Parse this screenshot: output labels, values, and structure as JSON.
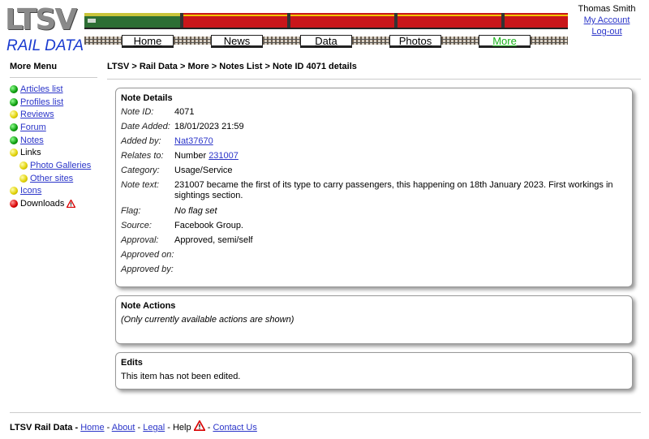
{
  "header": {
    "logo_text": "LTSV",
    "logo_subtext": "RAIL DATA",
    "nav": [
      {
        "label": "Home"
      },
      {
        "label": "News"
      },
      {
        "label": "Data"
      },
      {
        "label": "Photos"
      },
      {
        "label": "More"
      }
    ],
    "user": {
      "name": "Thomas Smith",
      "account": "My Account",
      "logout": "Log-out"
    }
  },
  "sidebar": {
    "title": "More Menu",
    "items": [
      {
        "label": "Articles list",
        "color": "#0a9a0a",
        "icon": "green-dot-icon",
        "link": true
      },
      {
        "label": "Profiles list",
        "color": "#0a9a0a",
        "icon": "green-dot-icon",
        "link": true
      },
      {
        "label": "Reviews",
        "color": "#e0d000",
        "icon": "yellow-dot-icon",
        "link": true
      },
      {
        "label": "Forum",
        "color": "#0a9a0a",
        "icon": "green-dot-icon",
        "link": true
      },
      {
        "label": "Notes",
        "color": "#0a9a0a",
        "icon": "green-dot-icon",
        "link": true
      },
      {
        "label": "Links",
        "color": "#e0d000",
        "icon": "yellow-dot-icon",
        "link": false
      },
      {
        "label": "Photo Galleries",
        "color": "#e0d000",
        "icon": "yellow-dot-icon",
        "link": true
      },
      {
        "label": "Other sites",
        "color": "#e0d000",
        "icon": "yellow-dot-icon",
        "link": true
      },
      {
        "label": "Icons",
        "color": "#e0d000",
        "icon": "yellow-dot-icon",
        "link": true
      },
      {
        "label": "Downloads",
        "color": "#d80000",
        "icon": "red-dot-icon",
        "link": false
      }
    ]
  },
  "breadcrumb": "LTSV > Rail Data > More > Notes List > Note ID 4071 details",
  "details": {
    "title": "Note Details",
    "note_id_label": "Note ID:",
    "note_id": "4071",
    "date_label": "Date Added:",
    "date": "18/01/2023 21:59",
    "added_by_label": "Added by:",
    "added_by": "Nat37670",
    "relates_label": "Relates to:",
    "relates_prefix": "Number ",
    "relates_link": "231007",
    "category_label": "Category:",
    "category": "Usage/Service",
    "text_label": "Note text:",
    "text": "231007 became the first of its type to carry passengers, this happening on 18th January 2023. First workings in sightings section.",
    "flag_label": "Flag:",
    "flag": "No flag set",
    "source_label": "Source:",
    "source": "Facebook Group.",
    "approval_label": "Approval:",
    "approval": "Approved, semi/self",
    "approved_on_label": "Approved on:",
    "approved_on": "",
    "approved_by_label": "Approved by:",
    "approved_by": ""
  },
  "actions": {
    "title": "Note Actions",
    "note": "(Only currently available actions are shown)"
  },
  "edits": {
    "title": "Edits",
    "text": "This item has not been edited."
  },
  "footer": {
    "site": "LTSV Rail Data",
    "home": "Home",
    "about": "About",
    "legal": "Legal",
    "help": "Help",
    "contact": "Contact Us"
  }
}
